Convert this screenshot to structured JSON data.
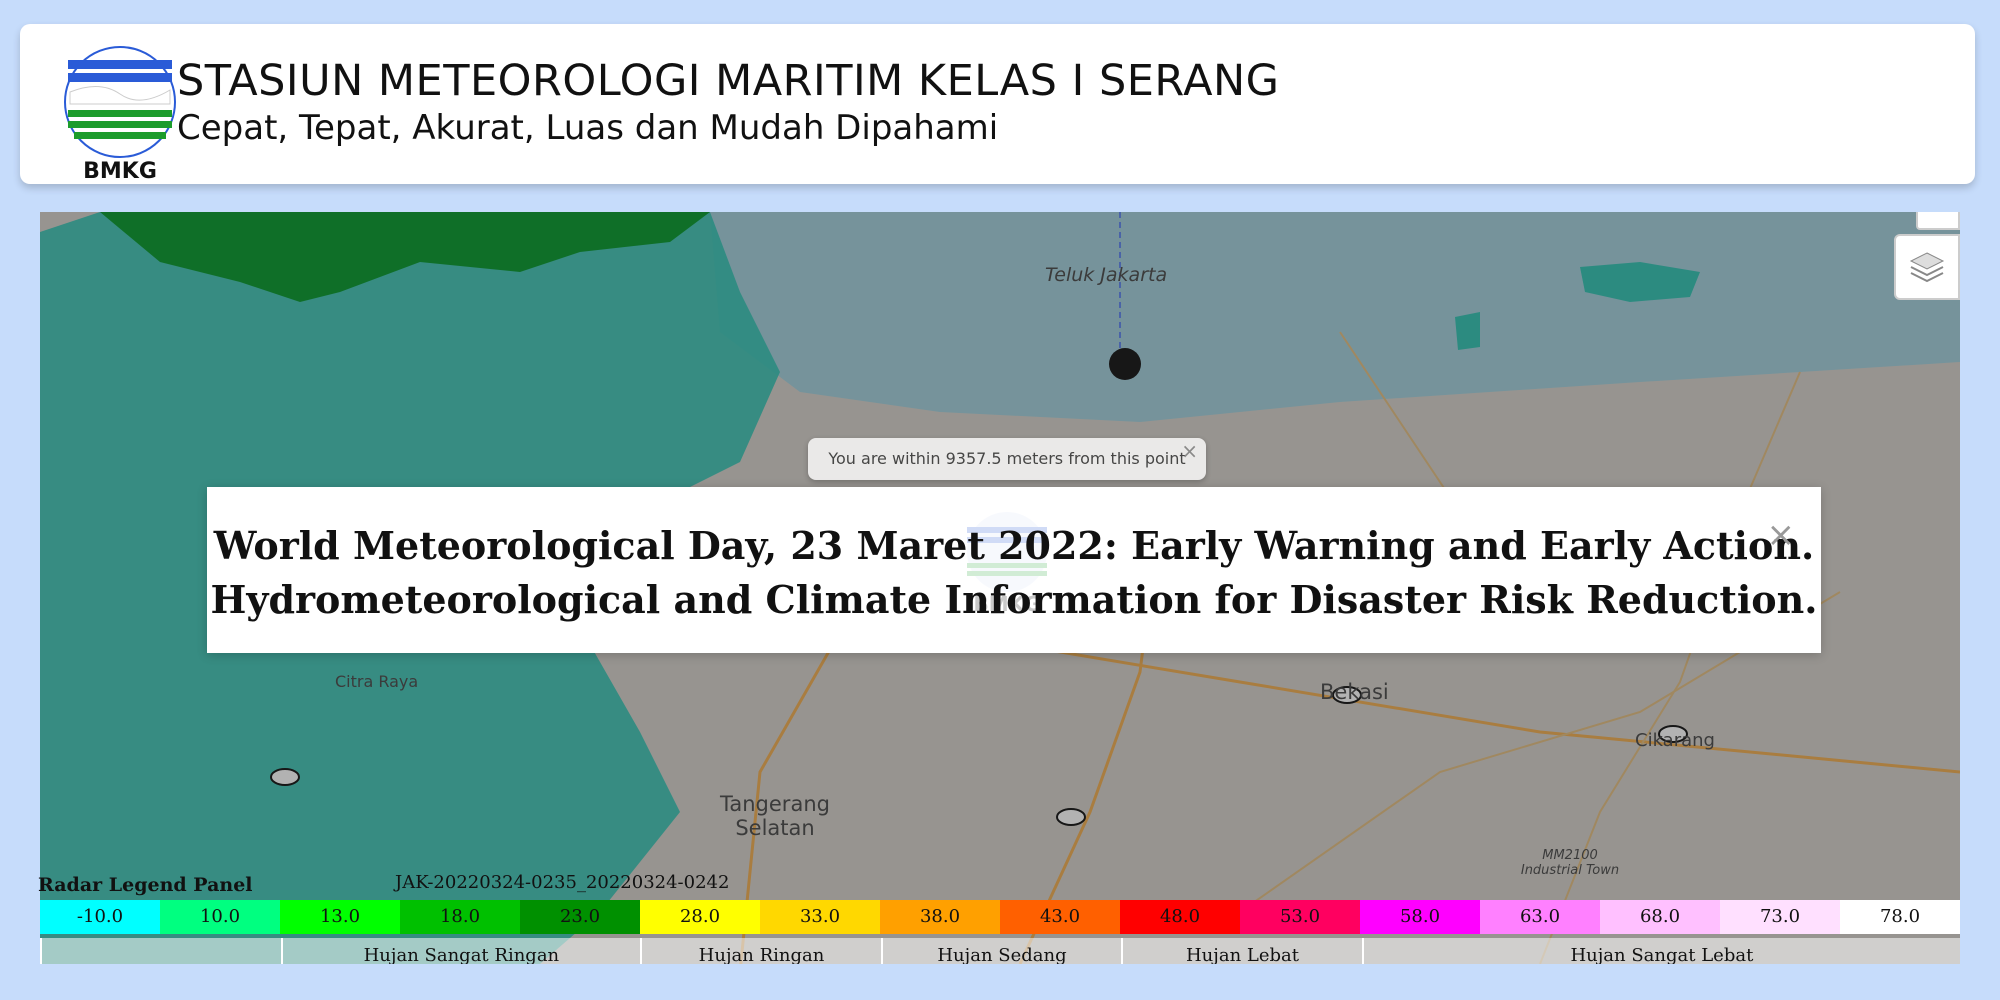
{
  "header": {
    "title": "STASIUN METEOROLOGI MARITIM KELAS I SERANG",
    "subtitle": "Cepat, Tepat, Akurat, Luas dan Mudah Dipahami",
    "logo_text": "BMKG",
    "logo_icon": "bmkg-logo"
  },
  "map": {
    "labels": {
      "bay": "Teluk Jakarta",
      "tangerang": "Tangerang Selatan",
      "bekasi": "Bekasi",
      "cikarang": "Cikarang",
      "citra_raya": "Citra Raya",
      "industrial": "MM2100 Industrial Town"
    },
    "tooltip": "You are within 9357.5 meters from this point",
    "layers_icon": "layers-icon"
  },
  "modal": {
    "line1": "World Meteorological Day, 23 Maret 2022: Early Warning and Early Action.",
    "line2": "Hydrometeorological and Climate Information for Disaster Risk Reduction.",
    "watermark": "BMKG",
    "close_label": "×"
  },
  "legend": {
    "title": "Radar Legend Panel",
    "timestamp": "JAK-20220324-0235_20220324-0242",
    "scale": [
      {
        "value": "-10.0",
        "color": "#00ffff"
      },
      {
        "value": "10.0",
        "color": "#00ff80"
      },
      {
        "value": "13.0",
        "color": "#00ff00"
      },
      {
        "value": "18.0",
        "color": "#00c000"
      },
      {
        "value": "23.0",
        "color": "#009000"
      },
      {
        "value": "28.0",
        "color": "#ffff00"
      },
      {
        "value": "33.0",
        "color": "#ffd800"
      },
      {
        "value": "38.0",
        "color": "#ffa000"
      },
      {
        "value": "43.0",
        "color": "#ff6000"
      },
      {
        "value": "48.0",
        "color": "#ff0000"
      },
      {
        "value": "53.0",
        "color": "#ff0060"
      },
      {
        "value": "58.0",
        "color": "#ff00ff"
      },
      {
        "value": "63.0",
        "color": "#ff80ff"
      },
      {
        "value": "68.0",
        "color": "#ffc0ff"
      },
      {
        "value": "73.0",
        "color": "#ffe0ff"
      },
      {
        "value": "78.0",
        "color": "#ffffff"
      }
    ],
    "categories": [
      {
        "label": "",
        "span": 2
      },
      {
        "label": "Hujan Sangat Ringan",
        "span": 3
      },
      {
        "label": "Hujan Ringan",
        "span": 2
      },
      {
        "label": "Hujan Sedang",
        "span": 2
      },
      {
        "label": "Hujan Lebat",
        "span": 2
      },
      {
        "label": "Hujan Sangat Lebat",
        "span": 5
      }
    ]
  }
}
